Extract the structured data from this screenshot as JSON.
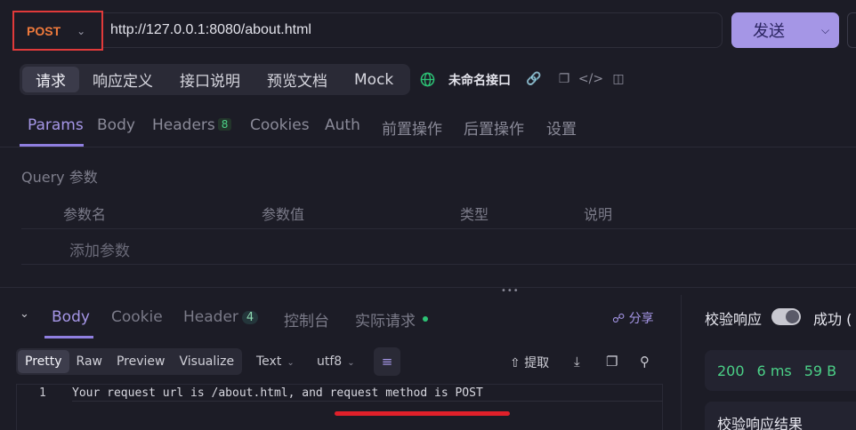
{
  "request": {
    "method": "POST",
    "url": "http://127.0.0.1:8080/about.html",
    "send_label": "发送"
  },
  "top_tabs": [
    {
      "label": "请求",
      "active": true
    },
    {
      "label": "响应定义",
      "active": false
    },
    {
      "label": "接口说明",
      "active": false
    },
    {
      "label": "预览文档",
      "active": false
    },
    {
      "label": "Mock",
      "active": false
    }
  ],
  "interface_name": "未命名接口",
  "param_tabs": [
    {
      "label": "Params",
      "active": true
    },
    {
      "label": "Body"
    },
    {
      "label": "Headers",
      "badge": "8"
    },
    {
      "label": "Cookies"
    },
    {
      "label": "Auth"
    },
    {
      "label": "前置操作"
    },
    {
      "label": "后置操作"
    },
    {
      "label": "设置"
    }
  ],
  "query": {
    "title": "Query 参数",
    "columns": [
      "参数名",
      "参数值",
      "类型",
      "说明"
    ],
    "add_placeholder": "添加参数"
  },
  "response": {
    "tabs": [
      {
        "label": "Body",
        "active": true
      },
      {
        "label": "Cookie"
      },
      {
        "label": "Header",
        "badge": "4"
      },
      {
        "label": "控制台"
      },
      {
        "label": "实际请求",
        "dot": true
      }
    ],
    "share_label": "分享",
    "formats": [
      {
        "label": "Pretty",
        "active": true
      },
      {
        "label": "Raw"
      },
      {
        "label": "Preview"
      },
      {
        "label": "Visualize"
      }
    ],
    "content_type": "Text",
    "encoding": "utf8",
    "extract_label": "提取",
    "line_number": "1",
    "body_text": "Your request url is /about.html, and request method is POST"
  },
  "validation": {
    "label": "校验响应",
    "toggle_on": true,
    "status_text": "成功 (",
    "status_code": "200",
    "time": "6 ms",
    "size": "59 B",
    "result_label": "校验响应结果"
  },
  "colors": {
    "accent": "#a596e6",
    "method_post": "#f07a3c",
    "success_green": "#4bd087",
    "highlight_red": "#e0202a"
  }
}
